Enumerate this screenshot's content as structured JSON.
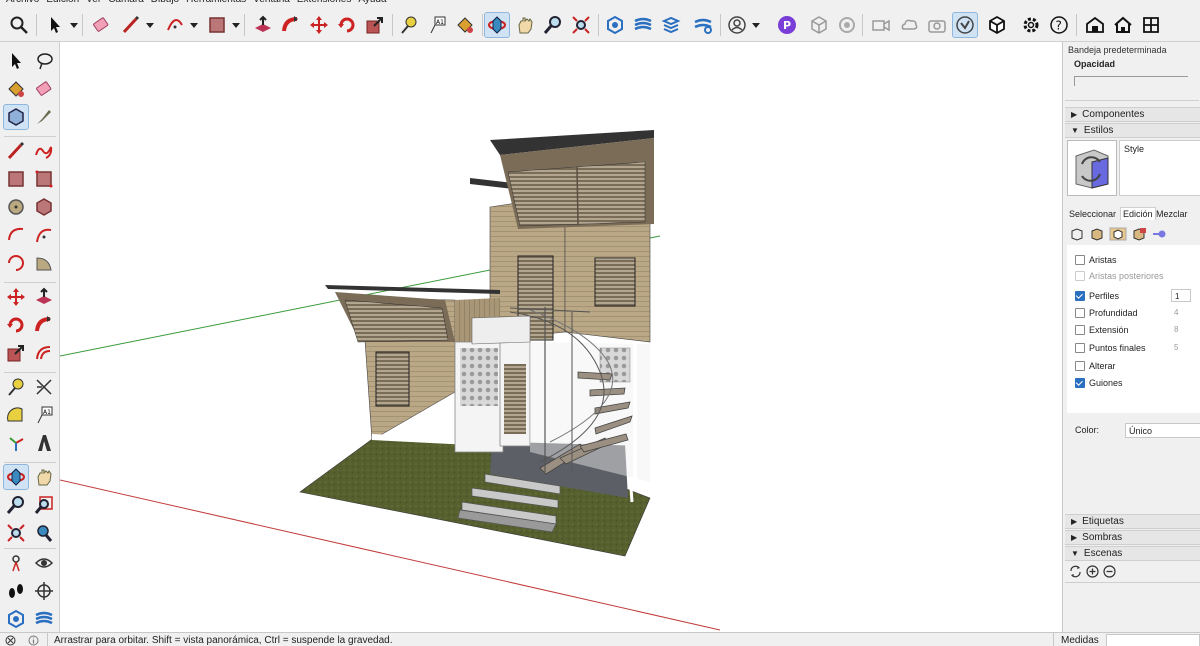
{
  "menu": [
    "Archivo",
    "Edición",
    "Ver",
    "Cámara",
    "Dibujo",
    "Herramientas",
    "Ventana",
    "Extensiones",
    "Ayuda"
  ],
  "toolbar": {
    "icons": [
      "search-icon",
      "select-arrow-icon",
      "eraser-icon",
      "pencil-line-icon",
      "arc-icon",
      "rectangle-icon",
      "push-pull-icon",
      "follow-me-icon",
      "move-icon",
      "rotate-icon",
      "scale-icon",
      "tape-measure-icon",
      "text-icon",
      "paint-bucket-icon",
      "orbit-icon",
      "pan-icon",
      "zoom-icon",
      "zoom-extents-icon",
      "sandbox-icon",
      "layers-icon",
      "stack-icon",
      "settings-icon",
      "user-icon",
      "p-badge-icon",
      "cube-outline-icon",
      "target-icon",
      "video-icon",
      "cloud-icon",
      "camera-icon",
      "check-badge-icon",
      "box-icon",
      "gear-icon",
      "help-icon",
      "warehouse-icon",
      "house-icon",
      "grid-icon"
    ]
  },
  "tray": {
    "title": "Bandeja predeterminada",
    "opacity_label": "Opacidad",
    "panels": {
      "componentes": "Componentes",
      "estilos": "Estilos",
      "etiquetas": "Etiquetas",
      "sombras": "Sombras",
      "escenas": "Escenas"
    },
    "style_name": "Style",
    "tabs": [
      "Seleccionar",
      "Edición",
      "Mezclar"
    ],
    "checkboxes": [
      {
        "label": "Aristas",
        "checked": false,
        "disabled": false,
        "value": ""
      },
      {
        "label": "Aristas posteriores",
        "checked": false,
        "disabled": true,
        "value": ""
      },
      {
        "label": "Perfiles",
        "checked": true,
        "disabled": false,
        "value": "1"
      },
      {
        "label": "Profundidad",
        "checked": false,
        "disabled": false,
        "value": "4"
      },
      {
        "label": "Extensión",
        "checked": false,
        "disabled": false,
        "value": "8"
      },
      {
        "label": "Puntos finales",
        "checked": false,
        "disabled": false,
        "value": "5"
      },
      {
        "label": "Alterar",
        "checked": false,
        "disabled": false,
        "value": ""
      },
      {
        "label": "Guiones",
        "checked": true,
        "disabled": false,
        "value": ""
      }
    ],
    "color_label": "Color:",
    "color_value": "Único"
  },
  "status": {
    "message": "Arrastrar para orbitar. Shift = vista panorámica, Ctrl = suspende la gravedad.",
    "measures_label": "Medidas"
  },
  "colors": {
    "accent": "#2a6fc0",
    "active_tool": "#cfe3f5",
    "red_axis": "#c33b3b",
    "green_axis": "#3a9a3a",
    "wood": "#b7a585",
    "grass": "#5b6436"
  }
}
